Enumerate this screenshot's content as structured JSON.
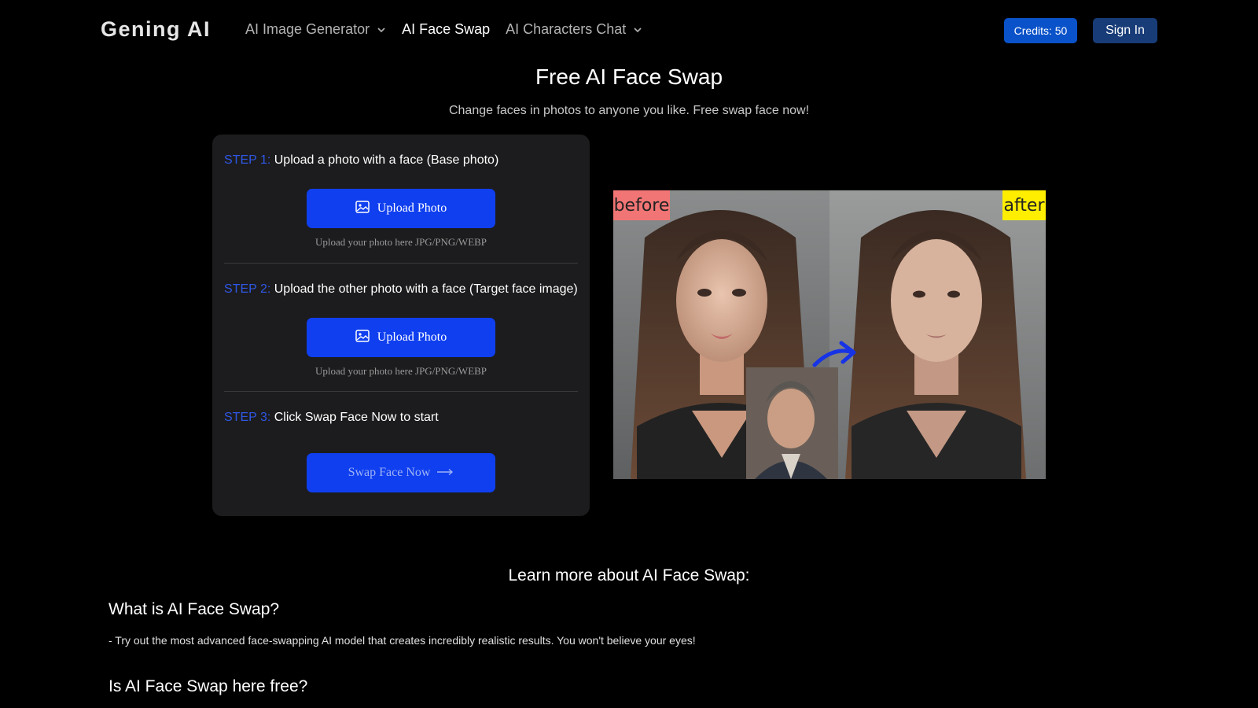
{
  "header": {
    "brand": "Gening AI",
    "nav": [
      {
        "label": "AI Image Generator",
        "has_dropdown": true
      },
      {
        "label": "AI Face Swap",
        "has_dropdown": false,
        "active": true
      },
      {
        "label": "AI Characters Chat",
        "has_dropdown": true
      }
    ],
    "credits_label": "Credits: 50",
    "signin_label": "Sign In"
  },
  "hero": {
    "title": "Free AI Face Swap",
    "subtitle": "Change faces in photos to anyone you like. Free swap face now!"
  },
  "steps": [
    {
      "label": "STEP 1:",
      "text": "Upload a photo with a face (Base photo)",
      "button": "Upload Photo",
      "hint": "Upload your photo here JPG/PNG/WEBP"
    },
    {
      "label": "STEP 2:",
      "text": "Upload the other photo with a face (Target face image)",
      "button": "Upload Photo",
      "hint": "Upload your photo here JPG/PNG/WEBP"
    },
    {
      "label": "STEP 3:",
      "text": "Click Swap Face Now to start",
      "button": "Swap Face Now"
    }
  ],
  "preview": {
    "before_tag": "before",
    "after_tag": "after"
  },
  "learn": {
    "title": "Learn more about AI Face Swap:",
    "faq": [
      {
        "question": "What is AI Face Swap?",
        "answer": "- Try out the most advanced face-swapping AI model that creates incredibly realistic results. You won't believe your eyes!"
      },
      {
        "question": "Is AI Face Swap here free?"
      }
    ]
  },
  "colors": {
    "accent": "#0f3fef",
    "step_label": "#2f57e6",
    "credits_bg": "#0a52c9",
    "signin_bg": "#183c78",
    "panel_bg": "#1c1c1e",
    "before_tag_bg": "#f27575",
    "after_tag_bg": "#ffee00"
  },
  "icons": [
    "chevron-down-icon",
    "image-icon",
    "arrow-right-icon",
    "swap-arrow-icon"
  ]
}
